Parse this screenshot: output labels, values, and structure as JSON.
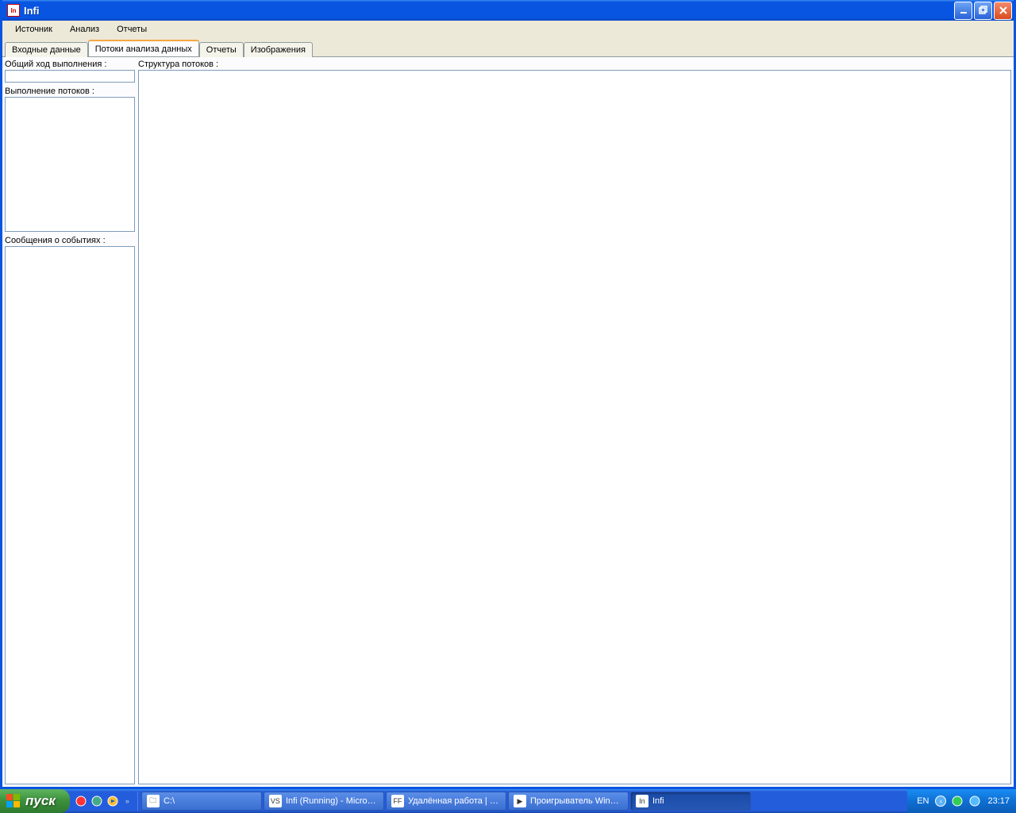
{
  "window": {
    "title": "Infi"
  },
  "menu": {
    "items": [
      "Источник",
      "Анализ",
      "Отчеты"
    ]
  },
  "tabs": {
    "items": [
      {
        "label": "Входные данные",
        "active": false
      },
      {
        "label": "Потоки анализа данных",
        "active": true
      },
      {
        "label": "Отчеты",
        "active": false
      },
      {
        "label": "Изображения",
        "active": false
      }
    ]
  },
  "panels": {
    "overall_progress_label": "Общий ход выполнения :",
    "thread_exec_label": "Выполнение потоков :",
    "events_label": "Сообщения о событиях :",
    "structure_label": "Структура потоков :"
  },
  "taskbar": {
    "start_label": "пуск",
    "tasks": [
      {
        "label": "C:\\",
        "icon": "🗀",
        "active": false
      },
      {
        "label": "Infi (Running) - Micro…",
        "icon": "VS",
        "active": false
      },
      {
        "label": "Удалённая работа | …",
        "icon": "FF",
        "active": false
      },
      {
        "label": "Проигрыватель Win…",
        "icon": "▶",
        "active": false
      },
      {
        "label": "Infi",
        "icon": "In",
        "active": true
      }
    ],
    "language": "EN",
    "clock": "23:17"
  }
}
